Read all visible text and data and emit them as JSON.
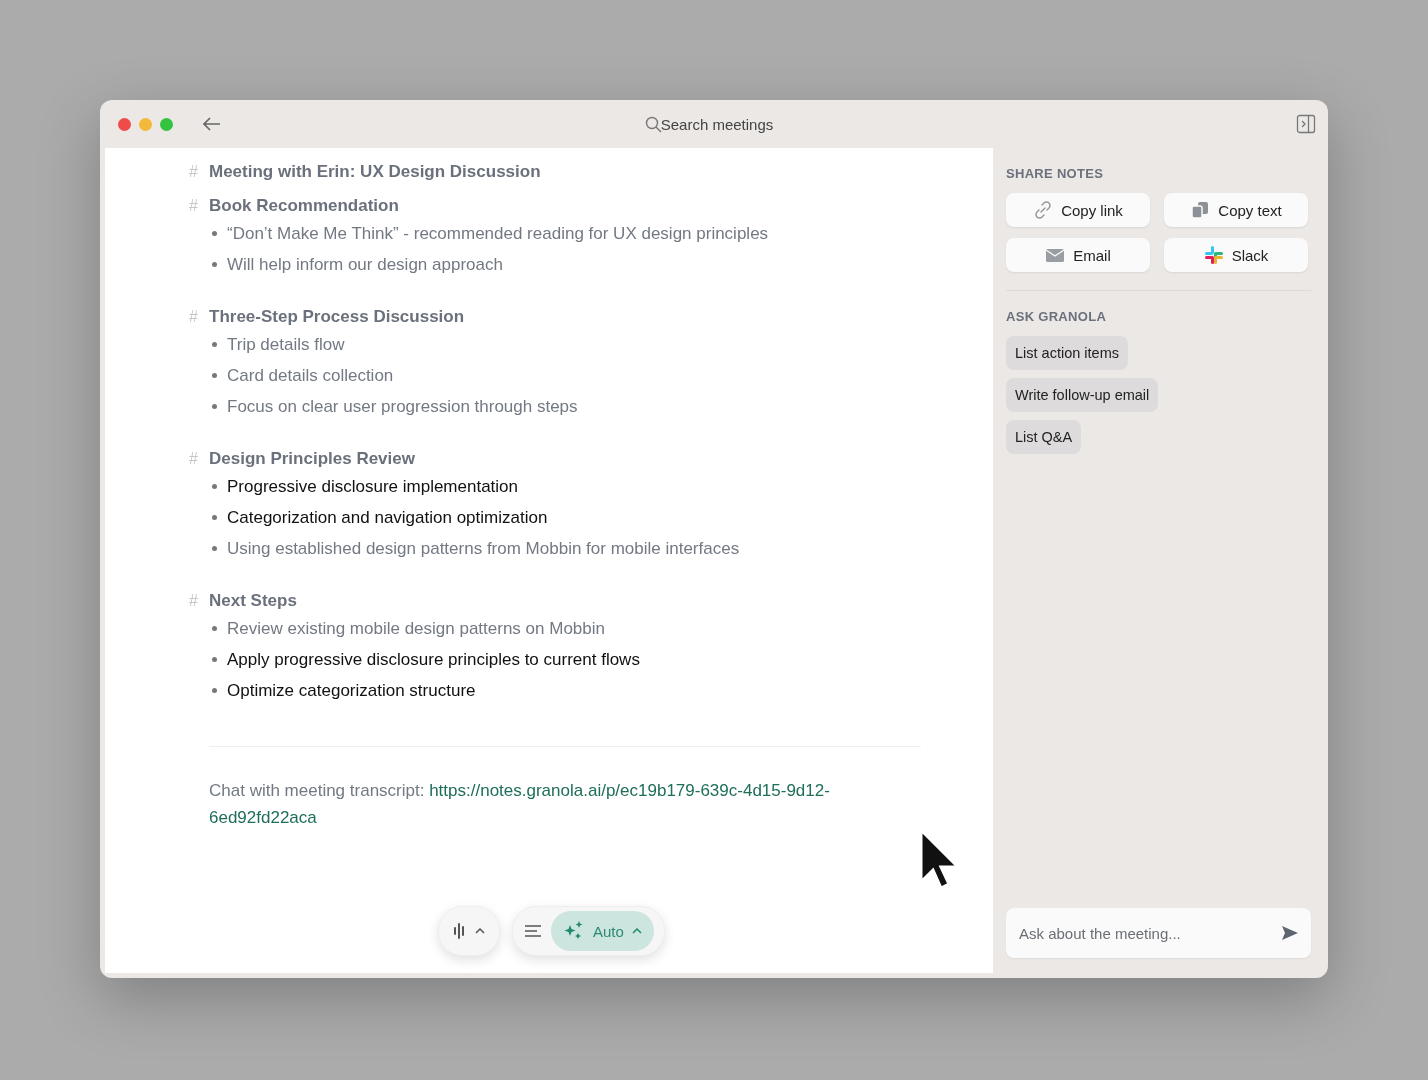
{
  "window": {
    "search": {
      "placeholder": "Search meetings"
    }
  },
  "notes": {
    "sections": [
      {
        "marker": "#",
        "heading": "Meeting with Erin: UX Design Discussion"
      },
      {
        "marker": "#",
        "heading": "Book Recommendation",
        "bullets": [
          {
            "text": "“Don’t Make Me Think” - recommended reading for UX design principles",
            "emphasized": false
          },
          {
            "text": "Will help inform our design approach",
            "emphasized": false
          }
        ]
      },
      {
        "marker": "#",
        "heading": "Three-Step Process Discussion",
        "bullets": [
          {
            "text": "Trip details flow",
            "emphasized": false
          },
          {
            "text": "Card details collection",
            "emphasized": false
          },
          {
            "text": "Focus on clear user progression through steps",
            "emphasized": false
          }
        ]
      },
      {
        "marker": "#",
        "heading": "Design Principles Review",
        "bullets": [
          {
            "text": "Progressive disclosure implementation",
            "emphasized": true
          },
          {
            "text": "Categorization and navigation optimization",
            "emphasized": true
          },
          {
            "text": "Using established design patterns from Mobbin for mobile interfaces",
            "emphasized": false
          }
        ]
      },
      {
        "marker": "#",
        "heading": "Next Steps",
        "bullets": [
          {
            "text": "Review existing mobile design patterns on Mobbin",
            "emphasized": false
          },
          {
            "text": "Apply progressive disclosure principles to current flows",
            "emphasized": true
          },
          {
            "text": "Optimize categorization structure",
            "emphasized": true
          }
        ]
      }
    ],
    "footer": {
      "label": "Chat with meeting transcript:",
      "link": "https://notes.granola.ai/p/ec19b179-639c-4d15-9d12-6ed92fd22aca"
    }
  },
  "toolbar": {
    "mode": {
      "label": "Auto",
      "selected": true
    }
  },
  "share_notes": {
    "title": "SHARE NOTES",
    "buttons": [
      {
        "kind": "link",
        "label": "Copy link"
      },
      {
        "kind": "copy",
        "label": "Copy text"
      },
      {
        "kind": "email",
        "label": "Email"
      },
      {
        "kind": "slack",
        "label": "Slack"
      }
    ]
  },
  "ask_granola": {
    "title": "ASK GRANOLA",
    "suggestions": [
      "List action items",
      "Write follow-up email",
      "List Q&A"
    ]
  },
  "chat_input": {
    "placeholder": "Ask about the meeting..."
  }
}
